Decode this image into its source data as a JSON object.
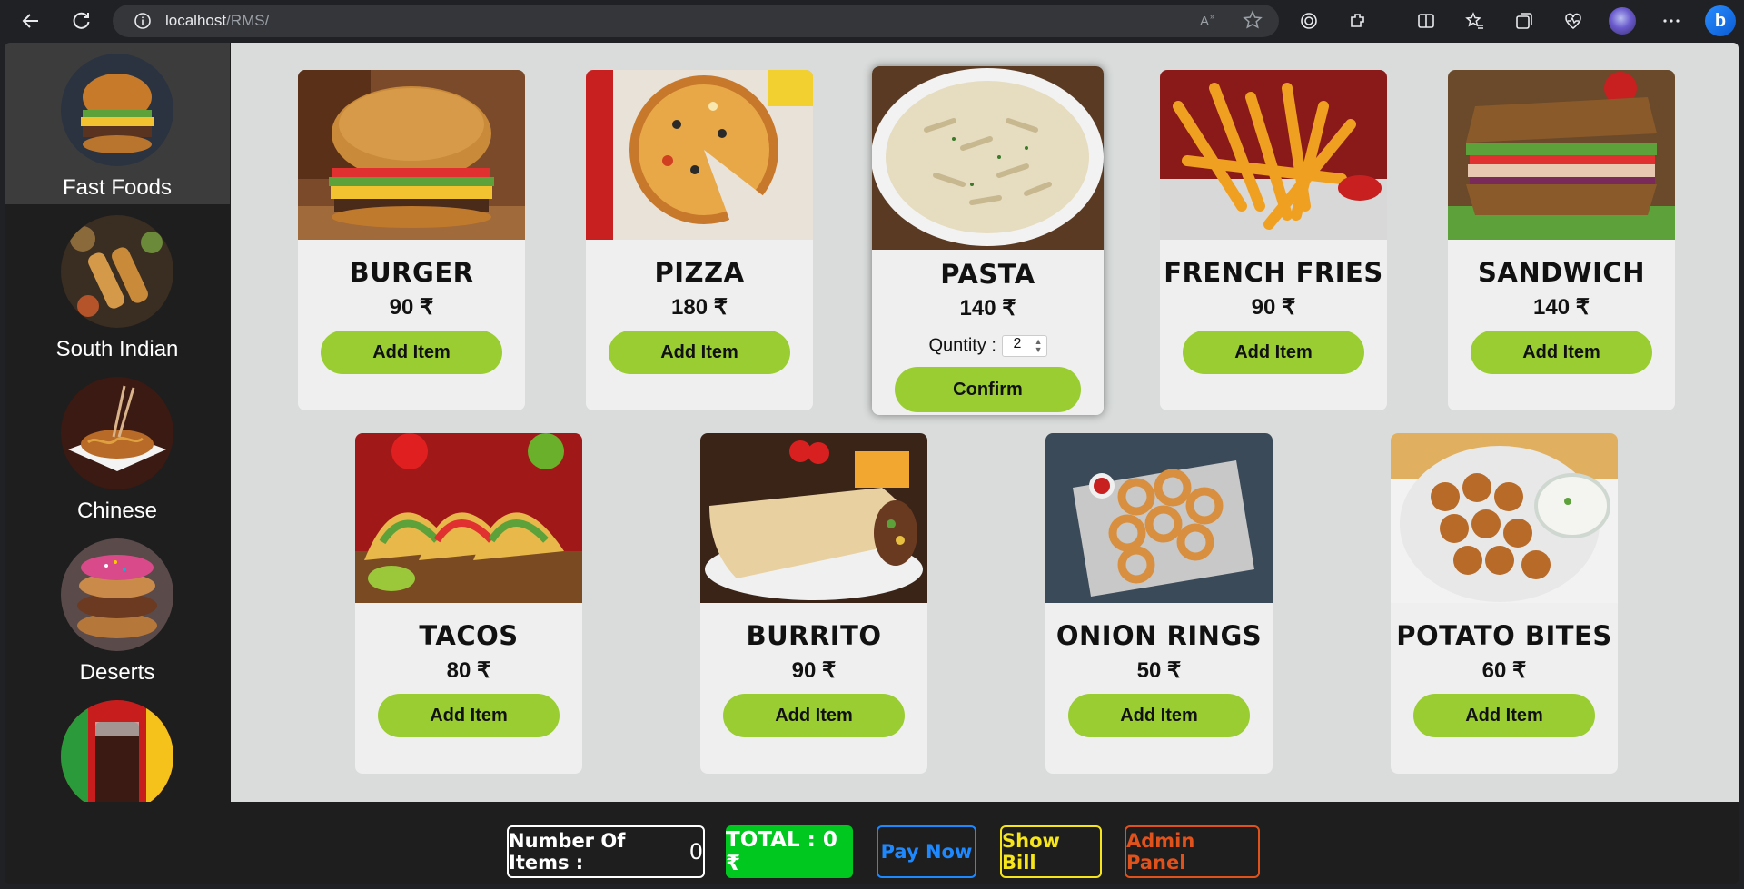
{
  "browser": {
    "url_host": "localhost",
    "url_path": "/RMS/"
  },
  "sidebar": {
    "categories": [
      {
        "label": "Fast Foods",
        "active": true
      },
      {
        "label": "South Indian",
        "active": false
      },
      {
        "label": "Chinese",
        "active": false
      },
      {
        "label": "Deserts",
        "active": false
      },
      {
        "label": "",
        "active": false
      }
    ]
  },
  "menu": {
    "items": [
      {
        "name": "Burger",
        "price": "90 ₹",
        "button": "Add Item"
      },
      {
        "name": "Pizza",
        "price": "180 ₹",
        "button": "Add Item"
      },
      {
        "name": "Pasta",
        "price": "140 ₹",
        "quantity_label": "Quntity :",
        "quantity_value": "2",
        "button": "Confirm"
      },
      {
        "name": "French Fries",
        "price": "90 ₹",
        "button": "Add Item"
      },
      {
        "name": "Sandwich",
        "price": "140 ₹",
        "button": "Add Item"
      },
      {
        "name": "Tacos",
        "price": "80 ₹",
        "button": "Add Item"
      },
      {
        "name": "Burrito",
        "price": "90 ₹",
        "button": "Add Item"
      },
      {
        "name": "Onion Rings",
        "price": "50 ₹",
        "button": "Add Item"
      },
      {
        "name": "Potato Bites",
        "price": "60 ₹",
        "button": "Add Item"
      }
    ]
  },
  "footer": {
    "items_label": "Number Of Items :",
    "items_value": "0",
    "total": "TOTAL : 0 ₹",
    "pay": "Pay Now",
    "bill": "Show Bill",
    "admin": "Admin Panel"
  },
  "colors": {
    "accent_green": "#9acd32",
    "total_green": "#00c81e",
    "pay_blue": "#1e88ff",
    "bill_yellow": "#f5e51a",
    "admin_orange": "#e0521c"
  }
}
